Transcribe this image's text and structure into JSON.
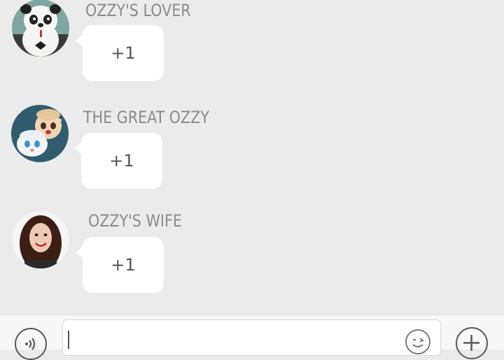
{
  "messages": [
    {
      "sender": "OZZY'S LOVER",
      "text": "+1",
      "avatar": "panda-avatar"
    },
    {
      "sender": "THE GREAT OZZY",
      "text": "+1",
      "avatar": "anime-children-avatar"
    },
    {
      "sender": "OZZY'S WIFE",
      "text": "+1",
      "avatar": "woman-portrait-avatar"
    }
  ],
  "input_bar": {
    "voice_icon": "voice-icon",
    "message_value": "",
    "emoji_icon": "emoji-icon",
    "plus_icon": "plus-icon"
  },
  "colors": {
    "background": "#ebebeb",
    "bubble": "#ffffff",
    "sender_text": "#8c8c8c",
    "bubble_text": "#555555"
  }
}
